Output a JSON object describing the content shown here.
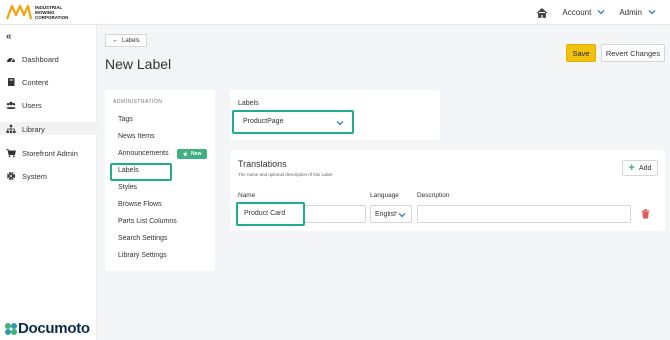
{
  "brand": {
    "logo_text": "INDUSTRIAL MOWING CORPORATION",
    "footer_logo": "Documoto",
    "accent": "#f2c10e",
    "highlight": "#1fad8e",
    "green": "#3fb07f"
  },
  "topbar": {
    "account_label": "Account",
    "admin_label": "Admin"
  },
  "sidebar": {
    "items": [
      {
        "label": "Dashboard",
        "icon": "dashboard-icon"
      },
      {
        "label": "Content",
        "icon": "book-icon"
      },
      {
        "label": "Users",
        "icon": "users-icon"
      },
      {
        "label": "Library",
        "icon": "sitemap-icon"
      },
      {
        "label": "Storefront Admin",
        "icon": "cart-icon"
      },
      {
        "label": "System",
        "icon": "gear-icon"
      }
    ]
  },
  "header": {
    "back_label": "Labels",
    "title": "New Label",
    "save_label": "Save",
    "revert_label": "Revert Changes"
  },
  "admin": {
    "heading": "ADMINISTRATION",
    "items": [
      {
        "label": "Tags"
      },
      {
        "label": "News Items"
      },
      {
        "label": "Announcements"
      },
      {
        "label": "Labels"
      },
      {
        "label": "Styles"
      },
      {
        "label": "Browse Flows"
      },
      {
        "label": "Parts List Columns"
      },
      {
        "label": "Search Settings"
      },
      {
        "label": "Library Settings"
      }
    ],
    "new_badge": "New"
  },
  "labels_panel": {
    "label": "Labels",
    "selected": "ProductPage"
  },
  "translations": {
    "title": "Translations",
    "subtitle": "The name and optional description of this Label",
    "add_label": "Add",
    "col_name": "Name",
    "col_language": "Language",
    "col_description": "Description",
    "row": {
      "name": "Product Card",
      "language": "English",
      "description": ""
    }
  }
}
